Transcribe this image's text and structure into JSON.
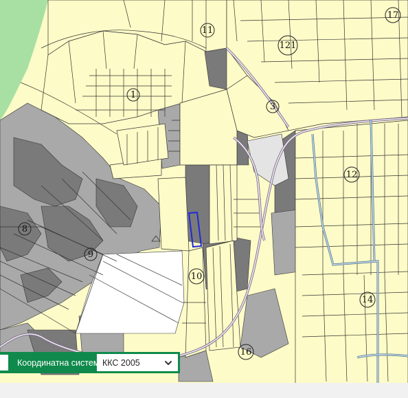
{
  "map": {
    "parcel_labels": [
      {
        "id": "17",
        "text": "17"
      },
      {
        "id": "11",
        "text": "11"
      },
      {
        "id": "121",
        "text": "121"
      },
      {
        "id": "1",
        "text": "1"
      },
      {
        "id": "3",
        "text": "3"
      },
      {
        "id": "12",
        "text": "12"
      },
      {
        "id": "8",
        "text": "8"
      },
      {
        "id": "9",
        "text": "9"
      },
      {
        "id": "10",
        "text": "10"
      },
      {
        "id": "14",
        "text": "14"
      },
      {
        "id": "16",
        "text": "16"
      }
    ],
    "highlight_color": "#1f2bd6",
    "colors": {
      "parcel": "#fdfbc7",
      "urban": "#7a7a7a",
      "grey": "#a9a9a9",
      "water": "#cfe6f0",
      "road": "#7e6f8c",
      "vegetation": "#a8e0a4"
    }
  },
  "crs": {
    "label": "Координатна система",
    "value": "ККС 2005",
    "icon": "chevron-down-icon",
    "bar_color": "#0f8a4c"
  }
}
